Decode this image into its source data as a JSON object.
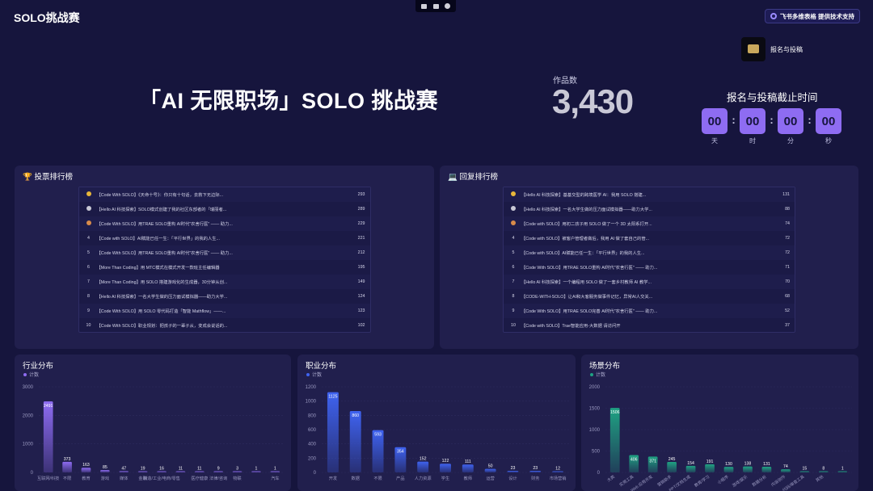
{
  "header": {
    "app_title": "SOLO挑战赛",
    "support_label": "飞书多维表格 提供技术支持",
    "register_label": "报名与投稿"
  },
  "hero": {
    "title": "「AI 无限职场」SOLO 挑战赛",
    "works_label": "作品数",
    "works_count": "3,430",
    "deadline_title": "报名与投稿截止时间",
    "countdown": [
      {
        "value": "00",
        "unit": "天"
      },
      {
        "value": "00",
        "unit": "时"
      },
      {
        "value": "00",
        "unit": "分"
      },
      {
        "value": "00",
        "unit": "秒"
      }
    ]
  },
  "vote_board": {
    "title": "🏆 投票排行榜",
    "rows": [
      {
        "rank": "1",
        "text": "【Code With SOLO】《天命十号》：你只有十句话，去救下无边际...",
        "score": "293"
      },
      {
        "rank": "2",
        "text": "【Hello AI 科技探索】SOLO模式创建了我的社区东部者的「瑞丽者...",
        "score": "289"
      },
      {
        "rank": "3",
        "text": "【Code With SOLO】用TRAE SOLO重构 AI时代\"农舍行医\" —— 助力...",
        "score": "229"
      },
      {
        "rank": "4",
        "text": "【Code with SOLO】AI赋能已任一生：「平行世界」的我的人生...",
        "score": "221"
      },
      {
        "rank": "5",
        "text": "【Code With SOLO】用TRAE SOLO重构 AI时代\"农舍行医\" —— 助力...",
        "score": "212"
      },
      {
        "rank": "6",
        "text": "【More Than Coding】用 MTC模式在模式开发一款班主任编辑器",
        "score": "195"
      },
      {
        "rank": "7",
        "text": "【More Than Coding】用 SOLO 搭建游戏化的生成器，30分钟从创...",
        "score": "149"
      },
      {
        "rank": "8",
        "text": "【Hello AI 科技探索】一名大学生做的压力面试模拟器——助力大学...",
        "score": "124"
      },
      {
        "rank": "9",
        "text": "【Code With SOLO】用 SOLO 零代码打造「智能 Mathflow」——...",
        "score": "123"
      },
      {
        "rank": "10",
        "text": "【Code With SOLO】职业规划：把孩子的一辈子从，变成会说话的...",
        "score": "102"
      }
    ]
  },
  "reply_board": {
    "title": "💻 回复排行榜",
    "rows": [
      {
        "rank": "1",
        "text": "【Hello AI 科技探索】基基交型的跨境医学 AI：我用 SOLO 搭建...",
        "score": "131"
      },
      {
        "rank": "2",
        "text": "【Hello AI 科技探索】一名大学生做的压力面试模拟器——助力大学...",
        "score": "88"
      },
      {
        "rank": "3",
        "text": "【Code with SOLO】用初二孩子用 SOLO 做了一个 3D 太阳系打开...",
        "score": "74"
      },
      {
        "rank": "4",
        "text": "【Code with SOLO】被客户管理者做后，我用 AI 做了套自己的管...",
        "score": "72"
      },
      {
        "rank": "5",
        "text": "【Code with SOLO】AI赋能已任一生：「平行世界」的我的人生...",
        "score": "72"
      },
      {
        "rank": "6",
        "text": "【Code With SOLO】用TRAE SOLO重构 AI时代\"农舍行医\" —— 助力...",
        "score": "71"
      },
      {
        "rank": "7",
        "text": "【Hello AI 科技探索】一个编程用 SOLO 做了一套乡村教师 AI 教学...",
        "score": "70"
      },
      {
        "rank": "8",
        "text": "【CODE-WITH-SOLO】让AI和大客服务做事件记忆，异常AI人交关...",
        "score": "68"
      },
      {
        "rank": "9",
        "text": "【Code With SOLO】用TRAE SOLO完善 AI时代\"农舍行医\" —— 助力...",
        "score": "52"
      },
      {
        "rank": "10",
        "text": "【Code with SOLO】Trae智能应用-大数据 请访问开",
        "score": "37"
      }
    ]
  },
  "chart_data": [
    {
      "type": "bar",
      "title": "行业分布",
      "legend": "计数",
      "color": "#8e6cf2",
      "categories": [
        "互联网/科技",
        "不限",
        "教育",
        "游戏",
        "媒体",
        "金融",
        "制造/工业",
        "电商/零售",
        "医疗健康",
        "法律/咨询",
        "物联",
        "",
        "汽车"
      ],
      "values": [
        2491,
        373,
        163,
        85,
        47,
        19,
        16,
        11,
        11,
        9,
        3,
        1,
        1
      ],
      "ylim": [
        0,
        3000
      ],
      "yticks": [
        0,
        1000,
        2000,
        3000
      ],
      "xlabels": [
        "互联网/科技",
        "不限",
        "教育",
        "游戏",
        "媒体",
        "金融",
        "制造/工业/电商/零售",
        "",
        "医疗健康",
        "法律/咨询",
        "物联",
        "",
        "汽车"
      ]
    },
    {
      "type": "bar",
      "title": "职业分布",
      "legend": "计数",
      "color": "#3f63f0",
      "categories": [
        "开发",
        "数据",
        "不限",
        "产品",
        "人力资源",
        "学生",
        "教师",
        "运营",
        "设计",
        "财务",
        "市场营销"
      ],
      "values": [
        1125,
        860,
        593,
        354,
        152,
        122,
        111,
        50,
        23,
        23,
        12
      ],
      "ylim": [
        0,
        1200
      ],
      "yticks": [
        0,
        200,
        400,
        600,
        800,
        1000,
        1200
      ],
      "xlabels": [
        "开发",
        "数据",
        "不限",
        "产品",
        "人力资源",
        "学生",
        "教师",
        "运营",
        "设计",
        "财务",
        "市场营销"
      ]
    },
    {
      "type": "bar",
      "title": "场景分布",
      "legend": "计数",
      "color": "#1fa283",
      "categories": [
        "大类",
        "实用工具",
        "Web 应用开发",
        "营销助手",
        "PPT/文档生成",
        "教育/学习",
        "小程序",
        "游戏/娱乐",
        "数据分析",
        "内容创作",
        "代码/审查工具",
        "其他"
      ],
      "values": [
        1506,
        406,
        371,
        245,
        154,
        191,
        130,
        138,
        131,
        74,
        15,
        8
      ],
      "extra_value": 1,
      "ylim": [
        0,
        2000
      ],
      "yticks": [
        0,
        500,
        1000,
        1500,
        2000
      ],
      "xlabels": [
        "大类",
        "实用工具",
        "Web 应用开发",
        "营销助手",
        "PPT/文档生成",
        "教育/学习",
        "小程序",
        "游戏/娱乐",
        "数据分析",
        "内容创作",
        "代码/审查工具",
        "其他"
      ]
    }
  ]
}
